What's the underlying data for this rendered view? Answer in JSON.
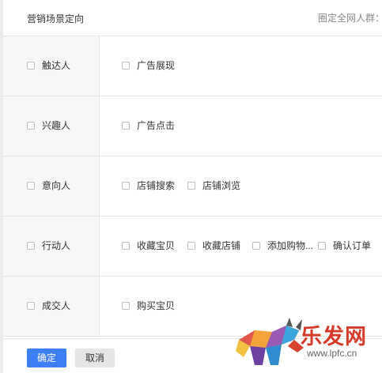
{
  "header": {
    "title": "营销场景定向",
    "right_label": "圈定全网人群："
  },
  "rows": [
    {
      "label": "触达人",
      "options": [
        "广告展现"
      ]
    },
    {
      "label": "兴趣人",
      "options": [
        "广告点击"
      ]
    },
    {
      "label": "意向人",
      "options": [
        "店铺搜索",
        "店铺浏览"
      ]
    },
    {
      "label": "行动人",
      "options": [
        "收藏宝贝",
        "收藏店铺",
        "添加购物...",
        "确认订单"
      ]
    },
    {
      "label": "成交人",
      "options": [
        "购买宝贝"
      ]
    }
  ],
  "footer": {
    "ok_label": "确定",
    "cancel_label": "取消"
  },
  "watermark": {
    "text": "乐发网",
    "url": "www.lpfc.cn"
  },
  "colors": {
    "primary": "#3d7ff5",
    "watermark": "#d63b2a"
  }
}
